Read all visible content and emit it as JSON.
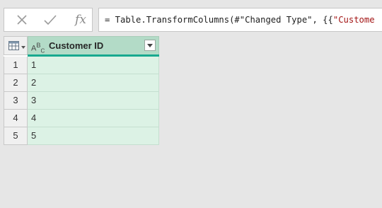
{
  "formula_bar": {
    "cancel_icon": "x-icon",
    "enter_icon": "check-icon",
    "insert_function_label": "fx",
    "formula_prefix": "= Table.TransformColumns(#\"Changed Type\", {{",
    "formula_string_part": "\"Custome"
  },
  "table": {
    "corner_icon": "table-icon",
    "column": {
      "type_icon": "ABC",
      "type_icon_main": "A",
      "type_icon_sup": "B",
      "type_icon_sub": "C",
      "name": "Customer ID",
      "filter_icon": "dropdown-arrow-icon"
    },
    "rows": [
      {
        "num": "1",
        "value": "1"
      },
      {
        "num": "2",
        "value": "2"
      },
      {
        "num": "3",
        "value": "3"
      },
      {
        "num": "4",
        "value": "4"
      },
      {
        "num": "5",
        "value": "5"
      }
    ]
  },
  "colors": {
    "background": "#e6e6e6",
    "column_header": "#b3dbc7",
    "column_accent": "#17a98f",
    "cell_fill": "#dcf2e5"
  }
}
